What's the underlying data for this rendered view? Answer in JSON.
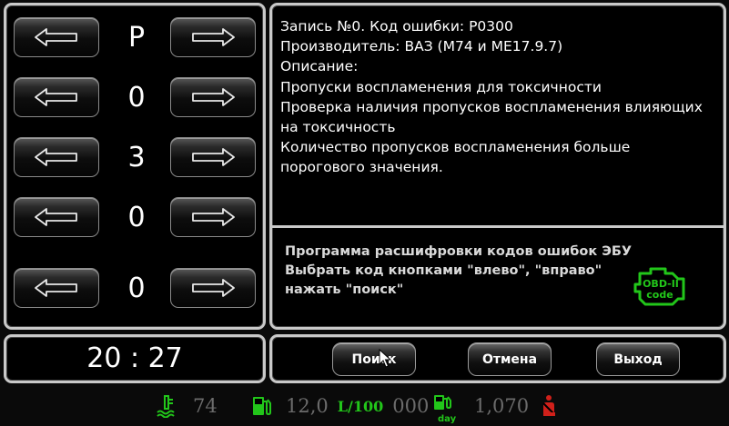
{
  "code": {
    "digits": [
      "P",
      "0",
      "3",
      "0",
      "0"
    ],
    "left_arrow_icon": "left-arrow-icon",
    "right_arrow_icon": "right-arrow-icon"
  },
  "info": {
    "lines": [
      "Запись №0. Код ошибки: P0300",
      "Производитель: ВАЗ (M74 и ME17.9.7)",
      "Описание:",
      "Пропуски воспламенения для токсичности",
      "Проверка наличия пропусков воспламенения влияющих на токсичность",
      "Количество пропусков воспламенения больше порогового значения."
    ]
  },
  "help": {
    "lines": [
      "Программа расшифровки кодов ошибок ЭБУ",
      "Выбрать код кнопками \"влево\", \"вправо\"",
      "нажать \"поиск\""
    ],
    "logo_line1": "OBD-II",
    "logo_line2": "code"
  },
  "clock": {
    "time": "20 : 27"
  },
  "actions": {
    "search_label": "Поиск",
    "cancel_label": "Отмена",
    "exit_label": "Выход"
  },
  "status_bar": {
    "coolant_temp": "74",
    "fuel_consumption": "12,0",
    "fuel_unit": "L/100",
    "distance": "000",
    "day_label": "day",
    "day_fuel": "1,070",
    "icons": [
      "coolant-temp-icon",
      "fuel-pump-icon",
      "day-fuel-icon",
      "seatbelt-icon"
    ],
    "colors": {
      "accent_green": "#22c61a",
      "value_gray": "#6b6b6b",
      "warning_red": "#d0201a"
    }
  }
}
